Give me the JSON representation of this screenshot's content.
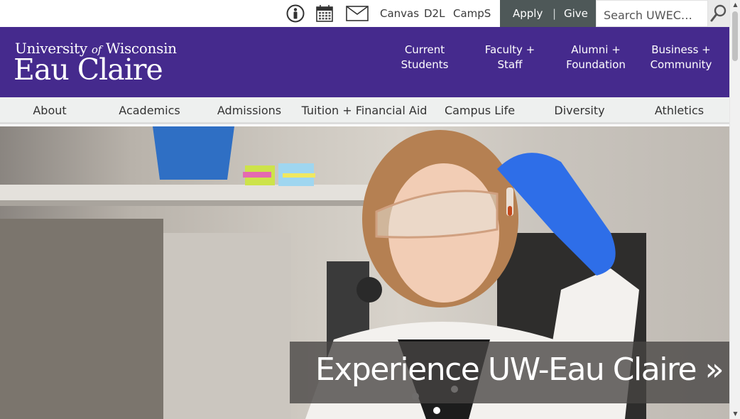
{
  "utility": {
    "icons": [
      "accessibility-icon",
      "calendar-icon",
      "mail-icon"
    ],
    "links": [
      "Canvas",
      "D2L",
      "CampS"
    ],
    "apply_label": "Apply",
    "separator": "|",
    "give_label": "Give",
    "search_placeholder": "Search UWEC…"
  },
  "header": {
    "logo_line1_a": "University",
    "logo_line1_of": "of",
    "logo_line1_b": "Wisconsin",
    "logo_line2": "Eau Claire",
    "audience": [
      {
        "line1": "Current",
        "line2": "Students"
      },
      {
        "line1": "Faculty +",
        "line2": "Staff"
      },
      {
        "line1": "Alumni +",
        "line2": "Foundation"
      },
      {
        "line1": "Business +",
        "line2": "Community"
      }
    ]
  },
  "nav": {
    "items": [
      "About",
      "Academics",
      "Admissions",
      "Tuition + Financial Aid",
      "Campus Life",
      "Diversity",
      "Athletics"
    ]
  },
  "hero": {
    "caption": "Experience UW-Eau Claire »"
  },
  "colors": {
    "brand_purple": "#452a8d",
    "apply_bg": "#4e5858",
    "nav_bg": "#eef0ef"
  }
}
